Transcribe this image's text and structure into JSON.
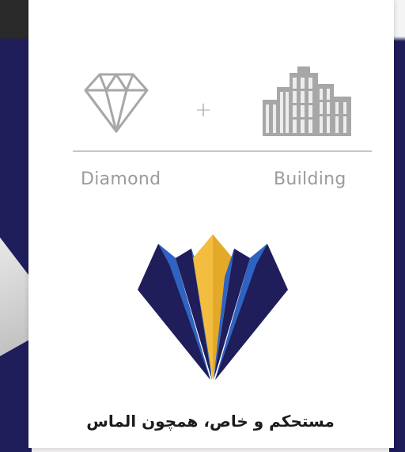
{
  "left_label": "Diamond",
  "right_label": "Building",
  "plus_sign": "+",
  "tagline": "مستحکم و خاص، همچون الماس",
  "icons": {
    "left": "diamond-icon",
    "center": "plus-icon",
    "right": "building-icon",
    "logo": "diamond-logo"
  },
  "colors": {
    "navy": "#1f1d5a",
    "blue": "#2e63c2",
    "gold": "#f3bd3f",
    "icon_gray": "#a7a7a7",
    "card": "#ffffff"
  }
}
